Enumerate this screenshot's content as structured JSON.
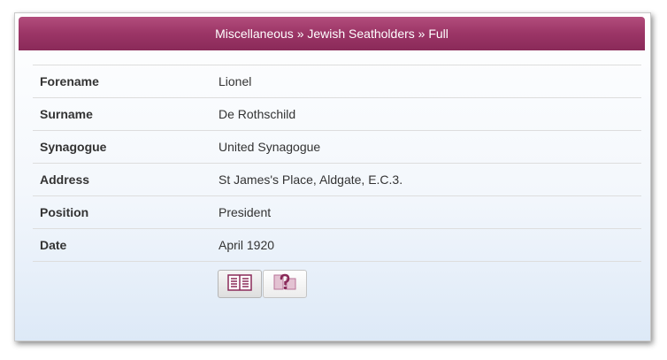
{
  "header": {
    "title": "Miscellaneous » Jewish Seatholders » Full"
  },
  "rows": [
    {
      "label": "Forename",
      "value": "Lionel"
    },
    {
      "label": "Surname",
      "value": "De Rothschild"
    },
    {
      "label": "Synagogue",
      "value": "United Synagogue"
    },
    {
      "label": "Address",
      "value": "St James's Place, Aldgate, E.C.3."
    },
    {
      "label": "Position",
      "value": "President"
    },
    {
      "label": "Date",
      "value": "April 1920"
    }
  ],
  "buttons": [
    {
      "icon": "transcript-icon"
    },
    {
      "icon": "help-icon"
    }
  ],
  "colors": {
    "header_bg": "#9b3566",
    "icon": "#8a2a59"
  }
}
